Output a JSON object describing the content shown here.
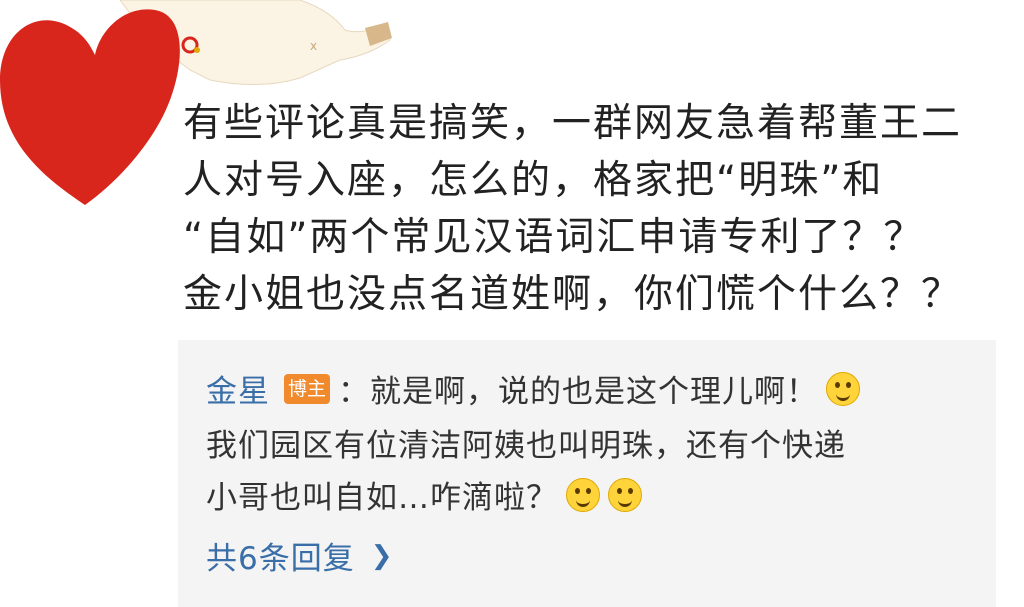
{
  "comment": {
    "lines": [
      "有些评论真是搞笑，一群网友急着帮董王二",
      "人对号入座，怎么的，格家把“明珠”和",
      "“自如”两个常见汉语词汇申请专利了？？",
      "金小姐也没点名道姓啊，你们慌个什么？？"
    ]
  },
  "reply": {
    "author": "金星",
    "badge": "博主",
    "line1": "：就是啊，说的也是这个理儿啊！",
    "line2": "我们园区有位清洁阿姨也叫明珠，还有个快递",
    "line3": "小哥也叫自如…咋滴啦？",
    "emojis": [
      "wink-tongue-emoji",
      "grin-emoji",
      "giggle-emoji"
    ]
  },
  "more": {
    "label": "共6条回复"
  },
  "colors": {
    "link": "#3a6ea8",
    "badge": "#f08a2c",
    "reply_bg": "#f4f4f4",
    "heart": "#d9261c"
  }
}
